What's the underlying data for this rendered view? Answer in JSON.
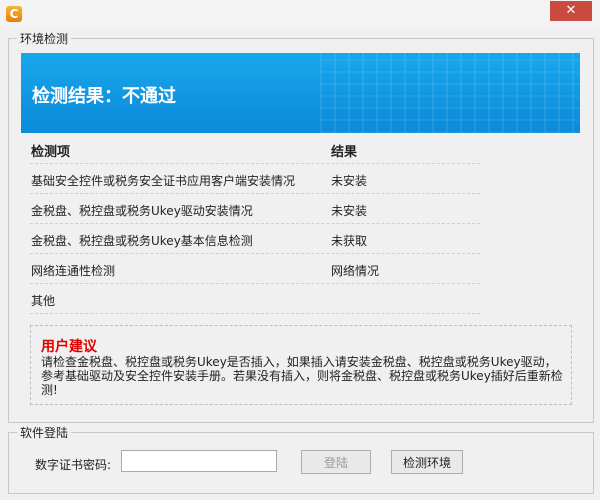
{
  "window": {
    "app_icon_letter": "C",
    "close_symbol": "✕"
  },
  "env_check": {
    "group_title": "环境检测",
    "result_title": "检测结果：不通过",
    "table": {
      "header": {
        "item": "检测项",
        "result": "结果"
      },
      "rows": [
        {
          "item": "基础安全控件或税务安全证书应用客户端安装情况",
          "result": "未安装"
        },
        {
          "item": "金税盘、税控盘或税务Ukey驱动安装情况",
          "result": "未安装"
        },
        {
          "item": "金税盘、税控盘或税务Ukey基本信息检测",
          "result": "未获取"
        },
        {
          "item": "网络连通性检测",
          "result": "网络情况"
        },
        {
          "item": "其他",
          "result": ""
        }
      ]
    },
    "advice": {
      "title": "用户建议",
      "text": "请检查金税盘、税控盘或税务Ukey是否插入，如果插入请安装金税盘、税控盘或税务Ukey驱动，参考基础驱动及安全控件安装手册。若果没有插入，则将金税盘、税控盘或税务Ukey插好后重新检测!"
    }
  },
  "login": {
    "group_title": "软件登陆",
    "password_label": "数字证书密码:",
    "password_value": "",
    "login_button": "登陆",
    "check_button": "检测环境"
  },
  "colors": {
    "banner": "#0b8ad8",
    "advice_title": "#e00000",
    "close": "#c94b3f"
  }
}
